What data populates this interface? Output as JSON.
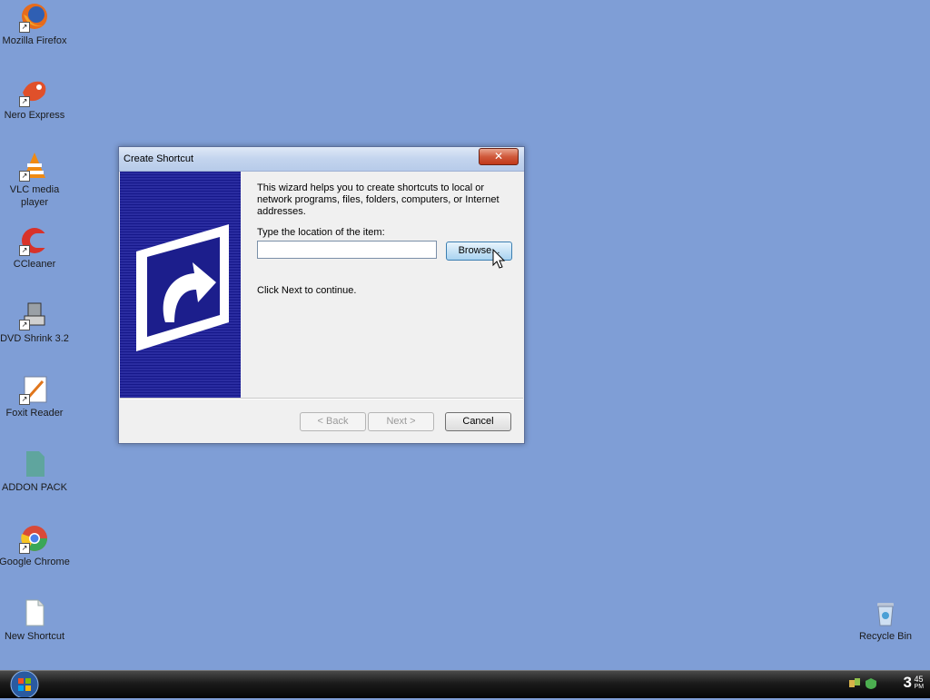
{
  "desktop": {
    "icons": [
      {
        "label": "Mozilla Firefox",
        "icon": "firefox-icon"
      },
      {
        "label": "Nero Express",
        "icon": "nero-icon"
      },
      {
        "label": "VLC media player",
        "icon": "vlc-icon"
      },
      {
        "label": "CCleaner",
        "icon": "ccleaner-icon"
      },
      {
        "label": "DVD Shrink 3.2",
        "icon": "dvd-shrink-icon"
      },
      {
        "label": "Foxit Reader",
        "icon": "foxit-icon"
      },
      {
        "label": "ADDON PACK",
        "icon": "addon-pack-icon"
      },
      {
        "label": "Google Chrome",
        "icon": "chrome-icon"
      },
      {
        "label": "New Shortcut",
        "icon": "file-icon"
      },
      {
        "label": "Recycle Bin",
        "icon": "recycle-bin-icon"
      }
    ]
  },
  "dialog": {
    "title": "Create Shortcut",
    "close_label": "✕",
    "intro": "This wizard helps you to create shortcuts to local or network programs, files, folders, computers, or Internet addresses.",
    "location_label": "Type the location of the item:",
    "location_value": "",
    "browse_label": "Browse...",
    "continue_text": "Click Next to continue.",
    "back_label": "< Back",
    "next_label": "Next >",
    "cancel_label": "Cancel"
  },
  "taskbar": {
    "clock_hour": "3",
    "clock_minute": "45",
    "clock_ampm": "PM"
  },
  "colors": {
    "desktop": "#7f9ed6",
    "banner": "#1c1e8c"
  }
}
